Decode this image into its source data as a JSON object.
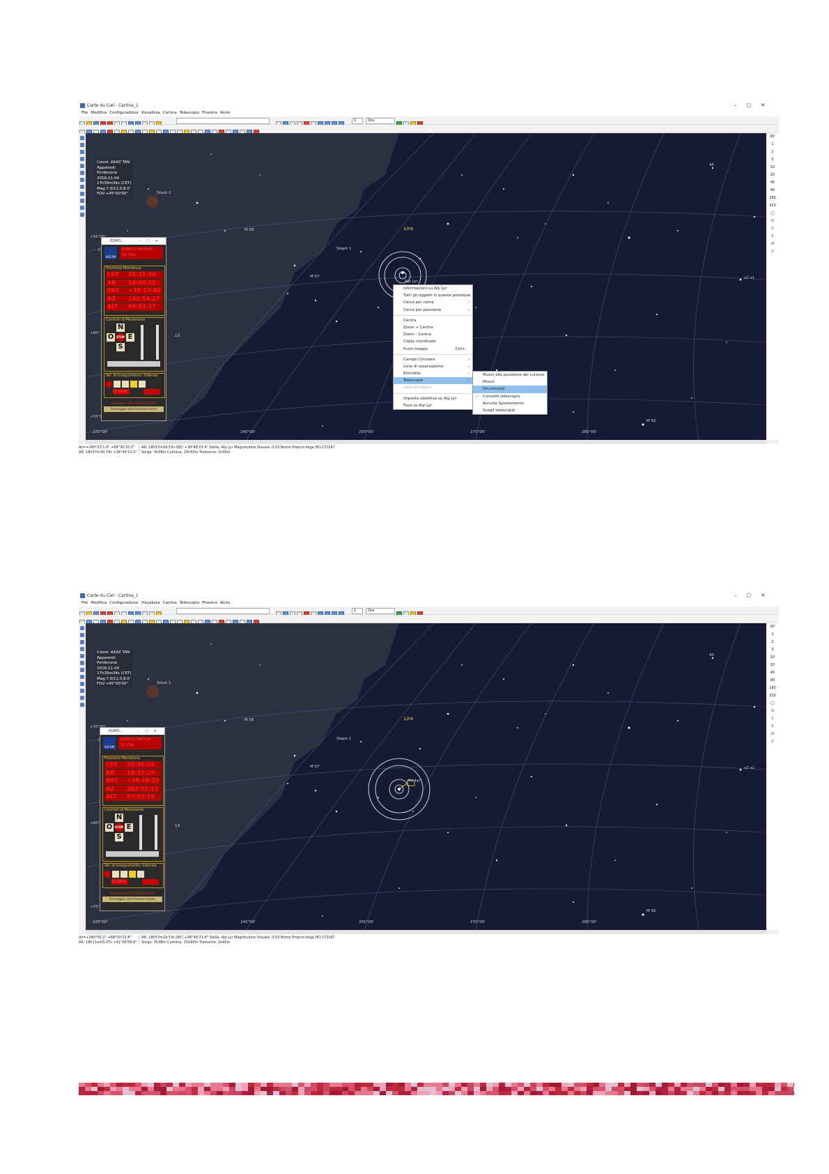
{
  "window": {
    "title": "Carte du Ciel - Cartina_1",
    "controls": [
      "–",
      "▢",
      "✕"
    ]
  },
  "menubar": [
    "File",
    "Modifica",
    "Configurazione",
    "Visualizza",
    "Cartina",
    "Telescopio",
    "Finestra",
    "Aiuto"
  ],
  "toolbar": {
    "search_value": "",
    "spin_value": "1",
    "unit_value": "Ora"
  },
  "infobox": {
    "lines": [
      "Coord. AltAZ TAN",
      "Apparenti",
      "Pordenone",
      "2016-11-04",
      "17h39m34s (CET)",
      "Mag:7.0/11.0,8.0'",
      "FOV:+45°00'00\""
    ]
  },
  "right_toolbar": {
    "fov": [
      "30'",
      "1",
      "2",
      "5",
      "10",
      "20",
      "45",
      "90",
      "180",
      "310"
    ],
    "dirs": [
      "N",
      "S",
      "E",
      "W",
      "Z"
    ]
  },
  "map_labels": {
    "stock1": "Stock 1",
    "lira": "Lira",
    "steph1": "Steph 1",
    "m56": "M 56",
    "m57": "M 57",
    "alp_lyr": "Alp Lyr",
    "m92": "M 92",
    "cr": "Cr",
    "num45": "45",
    "eps": "ε",
    "v": "ν2  ν1",
    "d": "13",
    "alt_left": "+55°00'",
    "alt_mid": "+60°",
    "alt_bottom": "+55°00'"
  },
  "az_ticks": [
    "225°00'",
    "240°00'",
    "255°00'",
    "270°00'",
    "285°00'"
  ],
  "eqmod_1": {
    "title": "EQMO...",
    "ascom": "ASCOM",
    "header_lines": [
      "EQMOD HEQ5/6",
      "V1.29a"
    ],
    "section_pos": "Posizione Montatura",
    "positions": [
      {
        "label": "LST",
        "value": "20:31:46"
      },
      {
        "label": "AR",
        "value": "18:40:15"
      },
      {
        "label": "DEC",
        "value": "+39:17:40"
      },
      {
        "label": "AZ",
        "value": "261:54:27"
      },
      {
        "label": "ALT",
        "value": "69:53:17"
      }
    ],
    "section_ctl": "Controlli di Movimento",
    "section_track": "Vel. di Inseguimento: Siderale",
    "ar_field": "15.0416",
    "footer_head": "Montatura NON PARCHEGGIATA",
    "footer_btn": "Parcheggia nella Posizione Home"
  },
  "eqmod_2": {
    "title": "EQMO...",
    "ascom": "ASCOM",
    "header_lines": [
      "EQMOD HEQ5/6",
      "V1.29a"
    ],
    "section_pos": "Posizione Montatura",
    "positions": [
      {
        "label": "LST",
        "value": "20:36:26"
      },
      {
        "label": "AR",
        "value": "18:37:29"
      },
      {
        "label": "DEC",
        "value": "+38:48:23"
      },
      {
        "label": "AZ",
        "value": "262:51:11"
      },
      {
        "label": "ALT",
        "value": "67:03:15"
      }
    ],
    "section_ctl": "Controlli di Movimento",
    "section_track": "Vel. di Inseguimento: Siderale",
    "ar_field": "15.0416",
    "footer_head": "Montatura NON PARCHEGGIATA",
    "footer_btn": "Parcheggia nella Posizione Home"
  },
  "context_menu": {
    "items": [
      {
        "label": "Informazioni su Alp Lyr",
        "arrow": false
      },
      {
        "label": "Tutti gli oggetti in questa posizione",
        "arrow": false
      },
      {
        "label": "Cerca per nome",
        "arrow": true
      },
      {
        "label": "Cerca per posizione",
        "arrow": true
      },
      {
        "sep": true
      },
      {
        "label": "Centra",
        "arrow": false
      },
      {
        "label": "Zoom + Centra",
        "arrow": false
      },
      {
        "label": "Zoom - Centra",
        "arrow": false
      },
      {
        "label": "Copia coordinate",
        "arrow": false
      },
      {
        "label": "Punti mappa",
        "arrow": false,
        "shortcut": "Ctrl+"
      },
      {
        "sep": true
      },
      {
        "label": "Campo Circolare",
        "arrow": true
      },
      {
        "label": "Lista di osservazione",
        "arrow": true
      },
      {
        "label": "Etichette",
        "arrow": true
      },
      {
        "label": "Telescopio",
        "arrow": true,
        "selected": true
      },
      {
        "label": "Lista immagini",
        "arrow": false,
        "disabled": true
      },
      {
        "sep": true
      },
      {
        "label": "Imposta obiettivo su Alp Lyr",
        "arrow": false
      },
      {
        "label": "Fuso su Alp Lyr",
        "arrow": false
      }
    ]
  },
  "submenu": {
    "items": [
      {
        "label": "Muovi alla posizione del cursore"
      },
      {
        "label": "Muovi"
      },
      {
        "label": "Sincronizza",
        "selected": true
      },
      {
        "label": "Connetti telescopio",
        "checked": true
      },
      {
        "label": "Annulla Spostamento"
      },
      {
        "label": "Scegli telescopio"
      }
    ]
  },
  "status_1": {
    "left": [
      "Az=+260°23'1.6\" +68°35'15.5\"",
      "AR: 18h37m30.74s +38°49'10.0\""
    ],
    "right": [
      "AR: 18h37m29.53s DEC:+38°48'23.4\"  Stella: Alp Lyr  Magnitudine Visuale: 0.03  Nome Proprio:Vega  HD:172167",
      "Sorge: 3h38m  Culmina: 15h50m  Tramonta: 1h45m"
    ]
  },
  "status_2": {
    "left": [
      "Az=+260°55.2\" +68°00'23.8\"",
      "AR: 18h11m03.37s +41°00'56.8\""
    ],
    "right": [
      "AR: 18h37m29.53s DEC:+38°48'23.4\"  Stella: Alp Lyr  Magnitudine Visuale: 0.03  Nome Proprio:Vega  HD:172167",
      "Sorge: 3h38m  Culmina: 15h50m  Tramonta: 1h45m"
    ]
  },
  "colors": {
    "sky": "#151a35",
    "ground": "#2a2f3e",
    "eqmod_red": "#b00000",
    "band_primary": "#c0283c"
  }
}
